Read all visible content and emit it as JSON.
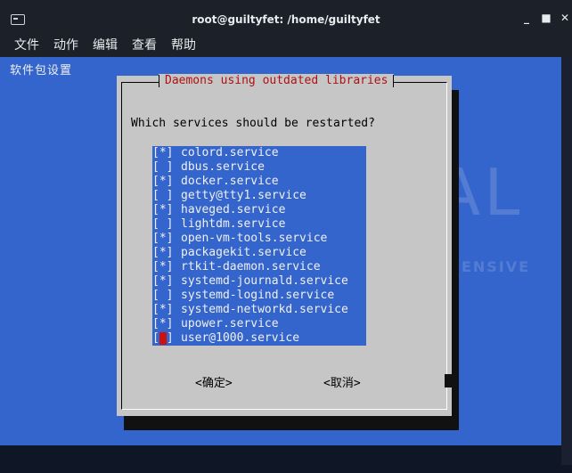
{
  "window": {
    "title": "root@guiltyfet: /home/guiltyfet",
    "buttons": [
      "_",
      "■",
      "✕"
    ]
  },
  "menu": [
    "文件",
    "动作",
    "编辑",
    "查看",
    "帮助"
  ],
  "terminal": {
    "header_line": "软件包设置"
  },
  "watermark": {
    "big": "KAL",
    "small": "BY OFFENSIVE SEC"
  },
  "dialog": {
    "title": "Daemons using outdated libraries",
    "question": "Which services should be restarted?",
    "items": [
      {
        "checked": true,
        "label": "colord.service"
      },
      {
        "checked": false,
        "label": "dbus.service"
      },
      {
        "checked": true,
        "label": "docker.service"
      },
      {
        "checked": false,
        "label": "getty@tty1.service"
      },
      {
        "checked": true,
        "label": "haveged.service"
      },
      {
        "checked": false,
        "label": "lightdm.service"
      },
      {
        "checked": true,
        "label": "open-vm-tools.service"
      },
      {
        "checked": true,
        "label": "packagekit.service"
      },
      {
        "checked": true,
        "label": "rtkit-daemon.service"
      },
      {
        "checked": true,
        "label": "systemd-journald.service"
      },
      {
        "checked": false,
        "label": "systemd-logind.service"
      },
      {
        "checked": true,
        "label": "systemd-networkd.service"
      },
      {
        "checked": true,
        "label": "upower.service"
      },
      {
        "checked": false,
        "label": "user@1000.service",
        "focused": true
      }
    ],
    "ok_label": "<确定>",
    "cancel_label": "<取消>"
  }
}
